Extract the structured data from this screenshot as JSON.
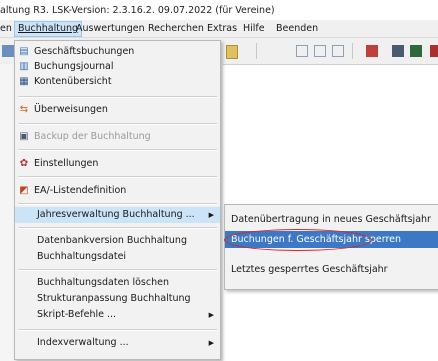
{
  "window": {
    "title": "altung R3.  LSK-Version: 2.3.16.2.  09.07.2022 (für Vereine)"
  },
  "menubar": {
    "items": [
      {
        "label": "en"
      },
      {
        "label": "Buchhaltung"
      },
      {
        "label": "Auswertungen"
      },
      {
        "label": "Recherchen"
      },
      {
        "label": "Extras"
      },
      {
        "label": "Hilfe"
      },
      {
        "label": "Beenden"
      }
    ]
  },
  "dropdown": {
    "items": [
      {
        "label": "Geschäftsbuchungen",
        "icon": "bookings-icon"
      },
      {
        "label": "Buchungsjournal",
        "icon": "journal-icon"
      },
      {
        "label": "Kontenübersicht",
        "icon": "accounts-overview-icon"
      },
      {
        "label": "Überweisungen",
        "icon": "transfer-icon"
      },
      {
        "label": "Backup der Buchhaltung",
        "icon": "backup-icon",
        "disabled": true
      },
      {
        "label": "Einstellungen",
        "icon": "settings-icon"
      },
      {
        "label": "EA/-Listendefinition",
        "icon": "list-definition-icon"
      },
      {
        "label": "Jahresverwaltung Buchhaltung ...",
        "highlighted": true,
        "submenu": true
      },
      {
        "label": "Datenbankversion Buchhaltung"
      },
      {
        "label": "Buchhaltungsdatei"
      },
      {
        "label": "Buchhaltungsdaten löschen"
      },
      {
        "label": "Strukturanpassung Buchhaltung"
      },
      {
        "label": "Skript-Befehle ...",
        "submenu": true
      },
      {
        "label": "Indexverwaltung ...",
        "submenu": true
      }
    ]
  },
  "submenu": {
    "items": [
      {
        "label": "Datenübertragung in neues Geschäftsjahr"
      },
      {
        "label": "Buchungen f. Geschäftsjahr sperren",
        "highlighted": true
      },
      {
        "label": "Letztes gesperrtes Geschäftsjahr"
      }
    ]
  },
  "colors": {
    "highlight": "#3d78c5",
    "hover": "#cce4f7",
    "annotation": "#dd2222"
  }
}
